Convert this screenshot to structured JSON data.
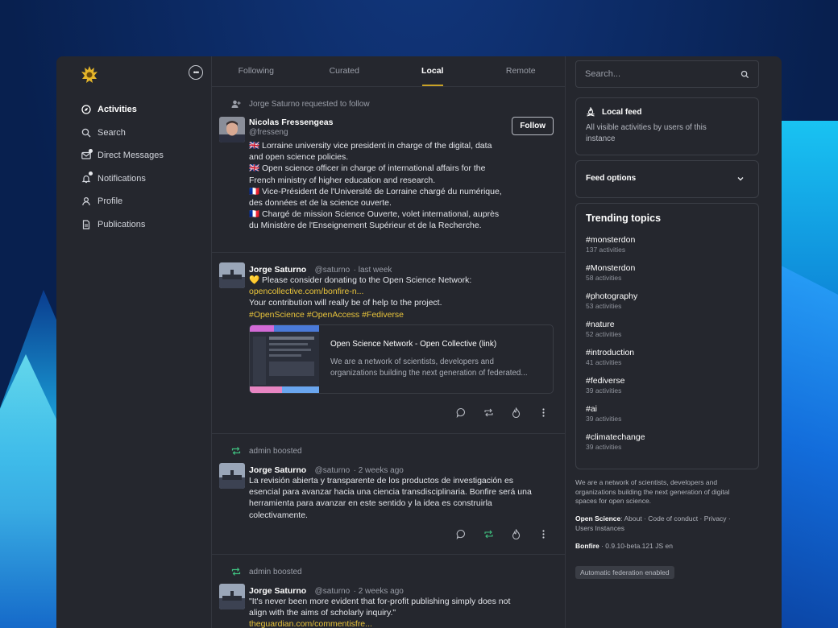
{
  "sidebar": {
    "items": [
      {
        "label": "Activities",
        "icon": "compass-icon",
        "active": true
      },
      {
        "label": "Search",
        "icon": "search-icon"
      },
      {
        "label": "Direct Messages",
        "icon": "mail-icon"
      },
      {
        "label": "Notifications",
        "icon": "bell-icon"
      },
      {
        "label": "Profile",
        "icon": "user-icon"
      },
      {
        "label": "Publications",
        "icon": "document-icon"
      }
    ]
  },
  "tabs": [
    "Following",
    "Curated",
    "Local",
    "Remote"
  ],
  "active_tab": "Local",
  "feed": {
    "follow_request": {
      "context": "Jorge Saturno requested to follow",
      "name": "Nicolas Fressengeas",
      "handle": "@fresseng",
      "follow_label": "Follow",
      "bio": [
        "🇬🇧 Lorraine university vice president in charge of the digital, data",
        "and open science policies.",
        "🇬🇧 Open science officer in charge of international affairs for the",
        "French ministry of higher education and research.",
        "🇫🇷 Vice-Président de l'Université de Lorraine chargé du numérique,",
        "des données et de la science ouverte.",
        "🇫🇷 Chargé de mission Science Ouverte, volet international, auprès",
        "du Ministère de l'Enseignement Supérieur et de la Recherche."
      ]
    },
    "post1": {
      "name": "Jorge Saturno",
      "handle": "@saturno",
      "time": "last week",
      "line1": "💛 Please consider donating to the Open Science Network:",
      "link": "opencollective.com/bonfire-n...",
      "line2": "Your contribution will really be of help to the project.",
      "tags": "#OpenScience #OpenAccess #Fediverse",
      "card_title": "Open Science Network - Open Collective (link)",
      "card_desc_1": "We are a network of scientists, developers and",
      "card_desc_2": "organizations building the next generation of federated..."
    },
    "post2": {
      "context": "admin boosted",
      "name": "Jorge Saturno",
      "handle": "@saturno",
      "time": "2 weeks ago",
      "lines": [
        "La revisión abierta y transparente de los productos de investigación es",
        "esencial para avanzar hacia una ciencia transdisciplinaria. Bonfire será una",
        "herramienta para avanzar en este sentido y la idea es construirla",
        "colectivamente."
      ]
    },
    "post3": {
      "context": "admin boosted",
      "name": "Jorge Saturno",
      "handle": "@saturno",
      "time": "2 weeks ago",
      "line1": "\"It's never been more evident that for-profit publishing simply does not",
      "line2": "align with the aims of scholarly inquiry.\"",
      "link": "theguardian.com/commentisfre..."
    }
  },
  "right": {
    "search_placeholder": "Search...",
    "local_feed_title": "Local feed",
    "local_feed_desc_1": "All visible activities by users of this",
    "local_feed_desc_2": "instance",
    "feed_options": "Feed options",
    "trending_title": "Trending topics",
    "topics": [
      {
        "tag": "#monsterdon",
        "count": "137 activities"
      },
      {
        "tag": "#Monsterdon",
        "count": "58 activities"
      },
      {
        "tag": "#photography",
        "count": "53 activities"
      },
      {
        "tag": "#nature",
        "count": "52 activities"
      },
      {
        "tag": "#introduction",
        "count": "41 activities"
      },
      {
        "tag": "#fediverse",
        "count": "39 activities"
      },
      {
        "tag": "#ai",
        "count": "39 activities"
      },
      {
        "tag": "#climatechange",
        "count": "39 activities"
      }
    ],
    "about_1": "We are a network of scientists, developers and",
    "about_2": "organizations building the next generation of digital",
    "about_3": "spaces for open science.",
    "links_brand": "Open Science",
    "links_1": ": About · Code of conduct · Privacy ·",
    "links_2": "Users Instances",
    "version_brand": "Bonfire",
    "version": " · 0.9.10-beta.121  JS  en",
    "federation_badge": "Automatic federation enabled"
  },
  "colors": {
    "accent": "#e9c43b",
    "boost": "#3fbf7f",
    "panel": "#25272e"
  }
}
